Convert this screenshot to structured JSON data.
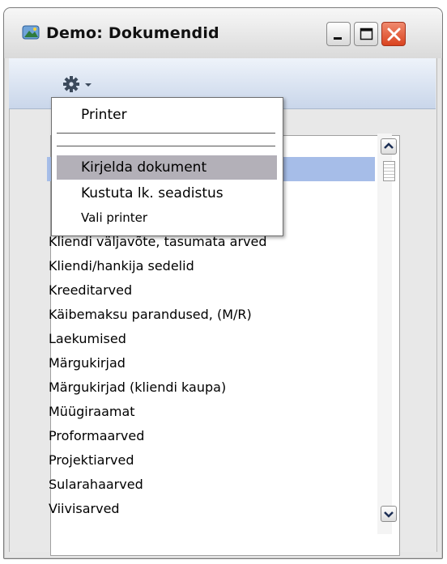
{
  "window": {
    "title": "Demo: Dokumendid",
    "icon": "app-icon",
    "buttons": [
      "minimize-icon",
      "maximize-icon",
      "close-icon"
    ]
  },
  "toolbar": {
    "icons": [
      "gear-icon",
      "chevron-down-icon"
    ]
  },
  "menu": {
    "items": [
      {
        "label": "Printer",
        "state": "normal"
      },
      {
        "label": "Kirjelda dokument",
        "state": "highlighted"
      },
      {
        "label": "Kustuta lk. seadistus",
        "state": "normal"
      },
      {
        "label": "Vali printer",
        "state": "normal"
      }
    ],
    "highlight_color": "#b3b0b8"
  },
  "list": {
    "visible_items": [
      "Kliendi väljavõte, tasumata arved",
      "Kliendi/hankija sedelid",
      "Kreeditarved",
      "Käibemaksu parandused, (M/R)",
      "Laekumised",
      "Märgukirjad",
      "Märgukirjad (kliendi kaupa)",
      "Müügiraamat",
      "Proformaarved",
      "Projektiarved",
      "Sularahaarved",
      "Viivisarved"
    ],
    "selection_color": "#a6bde8",
    "scroll_icons": [
      "scroll-up-icon",
      "scroll-down-icon"
    ]
  }
}
